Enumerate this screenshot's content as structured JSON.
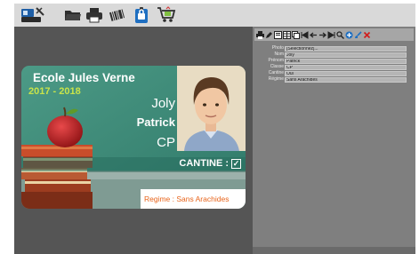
{
  "toolbar": {
    "items": [
      {
        "name": "card-printer-icon"
      },
      {
        "name": "folder-open-icon"
      },
      {
        "name": "printer-icon"
      },
      {
        "name": "barcode-icon"
      },
      {
        "name": "badge-lock-icon"
      },
      {
        "name": "cart-icon"
      }
    ]
  },
  "panel": {
    "tools": [
      {
        "name": "print-icon"
      },
      {
        "name": "pencil-icon"
      },
      {
        "name": "edit-form-icon"
      },
      {
        "name": "table-icon"
      },
      {
        "name": "copy-icon"
      },
      {
        "name": "first-record-icon"
      },
      {
        "name": "previous-record-icon"
      },
      {
        "name": "next-record-icon"
      },
      {
        "name": "last-record-icon"
      },
      {
        "name": "search-icon"
      },
      {
        "name": "add-icon"
      },
      {
        "name": "brush-icon"
      },
      {
        "name": "delete-icon"
      }
    ],
    "fields": [
      {
        "label": "Photo",
        "value": "[Sélectionnez]..."
      },
      {
        "label": "Nom",
        "value": "Joly"
      },
      {
        "label": "Prénom",
        "value": "Patrick"
      },
      {
        "label": "Classe",
        "value": "CP"
      },
      {
        "label": "Cantine",
        "value": "Oui"
      },
      {
        "label": "Régime",
        "value": "Sans Arachides"
      }
    ]
  },
  "card": {
    "school": "Ecole Jules Verne",
    "years": "2017 - 2018",
    "last_name": "Joly",
    "first_name": "Patrick",
    "class": "CP",
    "cantine_label": "CANTINE :",
    "cantine_check": "✓",
    "regime": "Regime : Sans Arachides"
  },
  "colors": {
    "chalkboard": "#3f8a78",
    "years": "#c8e34a",
    "regime_text": "#e8641b",
    "stage": "#555555",
    "panel": "#7f7f7f"
  }
}
